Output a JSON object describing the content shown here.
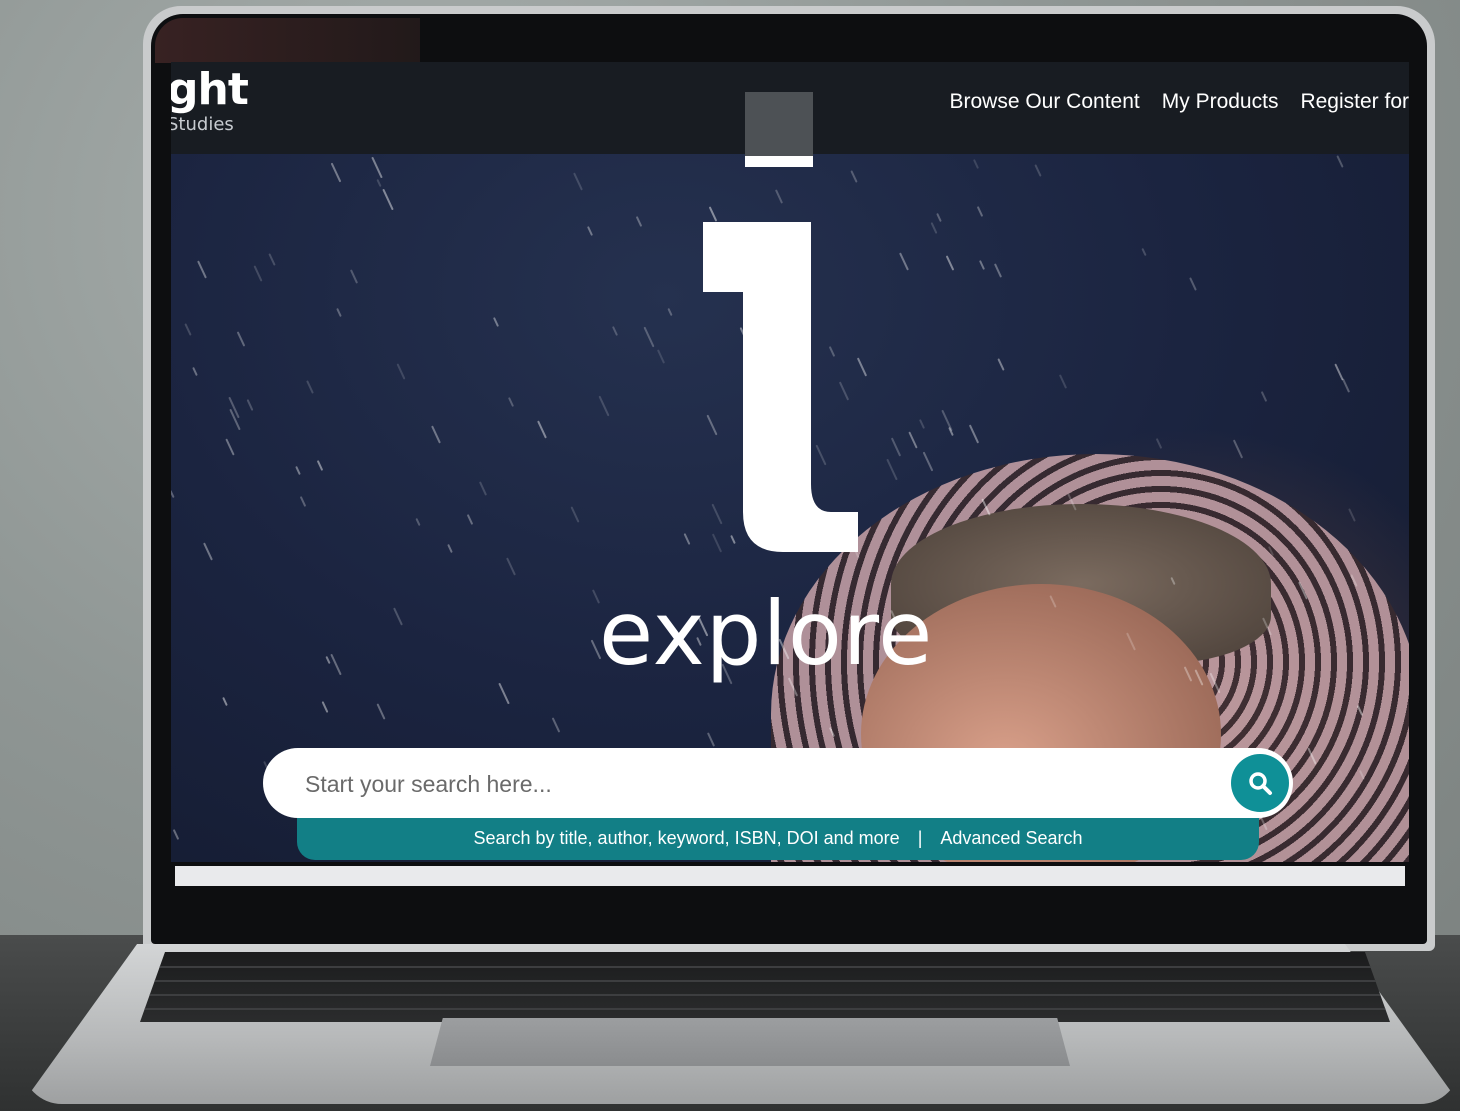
{
  "nav": {
    "brand_main": "ght",
    "brand_sub": "Studies",
    "links": [
      "Browse Our Content",
      "My Products",
      "Register for"
    ]
  },
  "hero": {
    "headline": "explore"
  },
  "search": {
    "placeholder": "Start your search here...",
    "helper_text": "Search by title, author, keyword, ISBN, DOI and more",
    "separator": "|",
    "advanced_label": "Advanced Search",
    "button_icon": "search-icon"
  },
  "colors": {
    "accent_teal": "#127f86",
    "search_button": "#0f9097",
    "navbar": "#181c22"
  }
}
